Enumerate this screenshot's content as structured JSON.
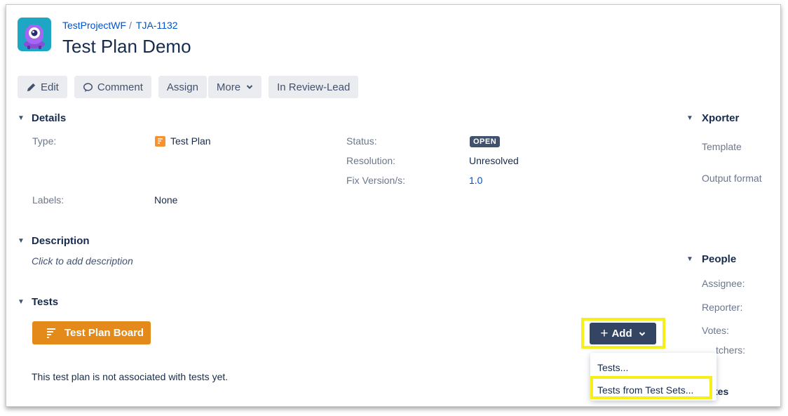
{
  "breadcrumb": {
    "project": "TestProjectWF",
    "separator": "/",
    "issue_key": "TJA-1132"
  },
  "issue": {
    "title": "Test Plan Demo"
  },
  "toolbar": {
    "edit": "Edit",
    "comment": "Comment",
    "assign": "Assign",
    "more": "More",
    "workflow": "In Review-Lead"
  },
  "details": {
    "heading": "Details",
    "type_label": "Type:",
    "type_value": "Test Plan",
    "status_label": "Status:",
    "status_value": "OPEN",
    "resolution_label": "Resolution:",
    "resolution_value": "Unresolved",
    "fix_label": "Fix Version/s:",
    "fix_value": "1.0",
    "labels_label": "Labels:",
    "labels_value": "None"
  },
  "description": {
    "heading": "Description",
    "placeholder": "Click to add description"
  },
  "tests": {
    "heading": "Tests",
    "board_button": "Test Plan Board",
    "add_button": "Add",
    "empty_message": "This test plan is not associated with tests yet.",
    "add_menu": [
      "Tests...",
      "Tests from Test Sets..."
    ]
  },
  "xporter": {
    "heading": "Xporter",
    "template_label": "Template",
    "output_label": "Output format"
  },
  "people": {
    "heading": "People",
    "assignee": "Assignee:",
    "reporter": "Reporter:",
    "votes": "Votes:",
    "watchers": "tchers:"
  },
  "dates": {
    "heading_fragment": "tes"
  },
  "colors": {
    "accent": "#0052cc",
    "board_button": "#e38a1b",
    "add_button": "#344563",
    "highlight": "#f6ef1a"
  }
}
